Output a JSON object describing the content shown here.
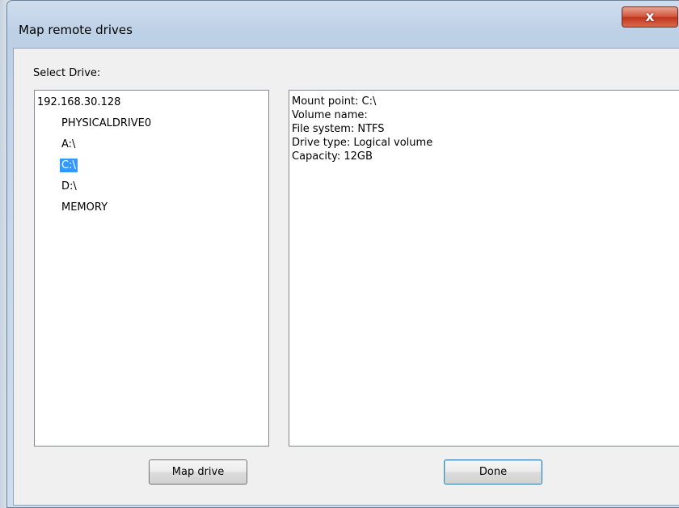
{
  "window": {
    "title": "Map remote drives",
    "close_label": "x"
  },
  "drive_selector": {
    "label": "Select Drive:",
    "root": "192.168.30.128",
    "drives": [
      {
        "label": "PHYSICALDRIVE0",
        "selected": false
      },
      {
        "label": "A:\\",
        "selected": false
      },
      {
        "label": "C:\\",
        "selected": true
      },
      {
        "label": "D:\\",
        "selected": false
      },
      {
        "label": "MEMORY",
        "selected": false
      }
    ]
  },
  "drive_info": {
    "lines": [
      "Mount point: C:\\",
      "Volume name:",
      "File system: NTFS",
      "Drive type: Logical volume",
      "Capacity: 12GB"
    ]
  },
  "buttons": {
    "map_drive": "Map drive",
    "done": "Done"
  },
  "colors": {
    "selection": "#3399ff",
    "close_button": "#c2351b"
  }
}
